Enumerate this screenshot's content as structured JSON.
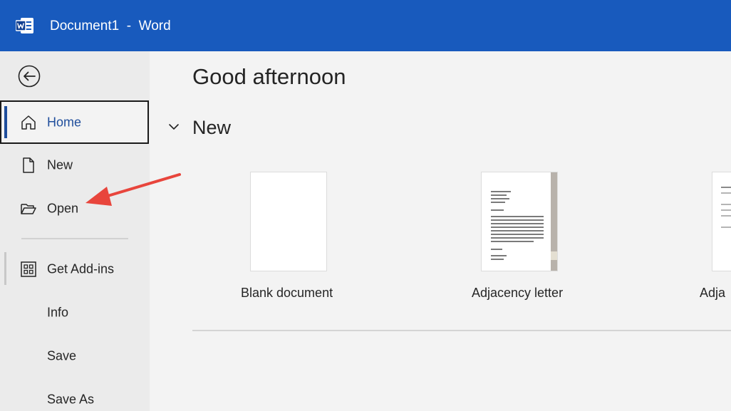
{
  "window": {
    "title": "Document1  -  Word",
    "app_icon": "word-logo-icon",
    "title_bar_color": "#185abd"
  },
  "sidebar": {
    "back_icon": "back-arrow-icon",
    "items": [
      {
        "id": "home",
        "label": "Home",
        "icon": "home-icon",
        "selected": true
      },
      {
        "id": "new",
        "label": "New",
        "icon": "new-document-icon"
      },
      {
        "id": "open",
        "label": "Open",
        "icon": "folder-open-icon"
      },
      {
        "id": "addins",
        "label": "Get Add-ins",
        "icon": "grid-apps-icon"
      },
      {
        "id": "info",
        "label": "Info"
      },
      {
        "id": "save",
        "label": "Save"
      },
      {
        "id": "saveas",
        "label": "Save As"
      }
    ]
  },
  "main": {
    "greeting": "Good afternoon",
    "new_section": {
      "title": "New",
      "templates": [
        {
          "label": "Blank document"
        },
        {
          "label": "Adjacency letter"
        },
        {
          "label": "Adja"
        }
      ]
    }
  },
  "annotation": {
    "arrow_color": "#e8453c",
    "points_to": "Open"
  },
  "colors": {
    "accent": "#1f4e9c",
    "sidebar_bg": "#ebebeb",
    "main_bg": "#f3f3f3"
  }
}
